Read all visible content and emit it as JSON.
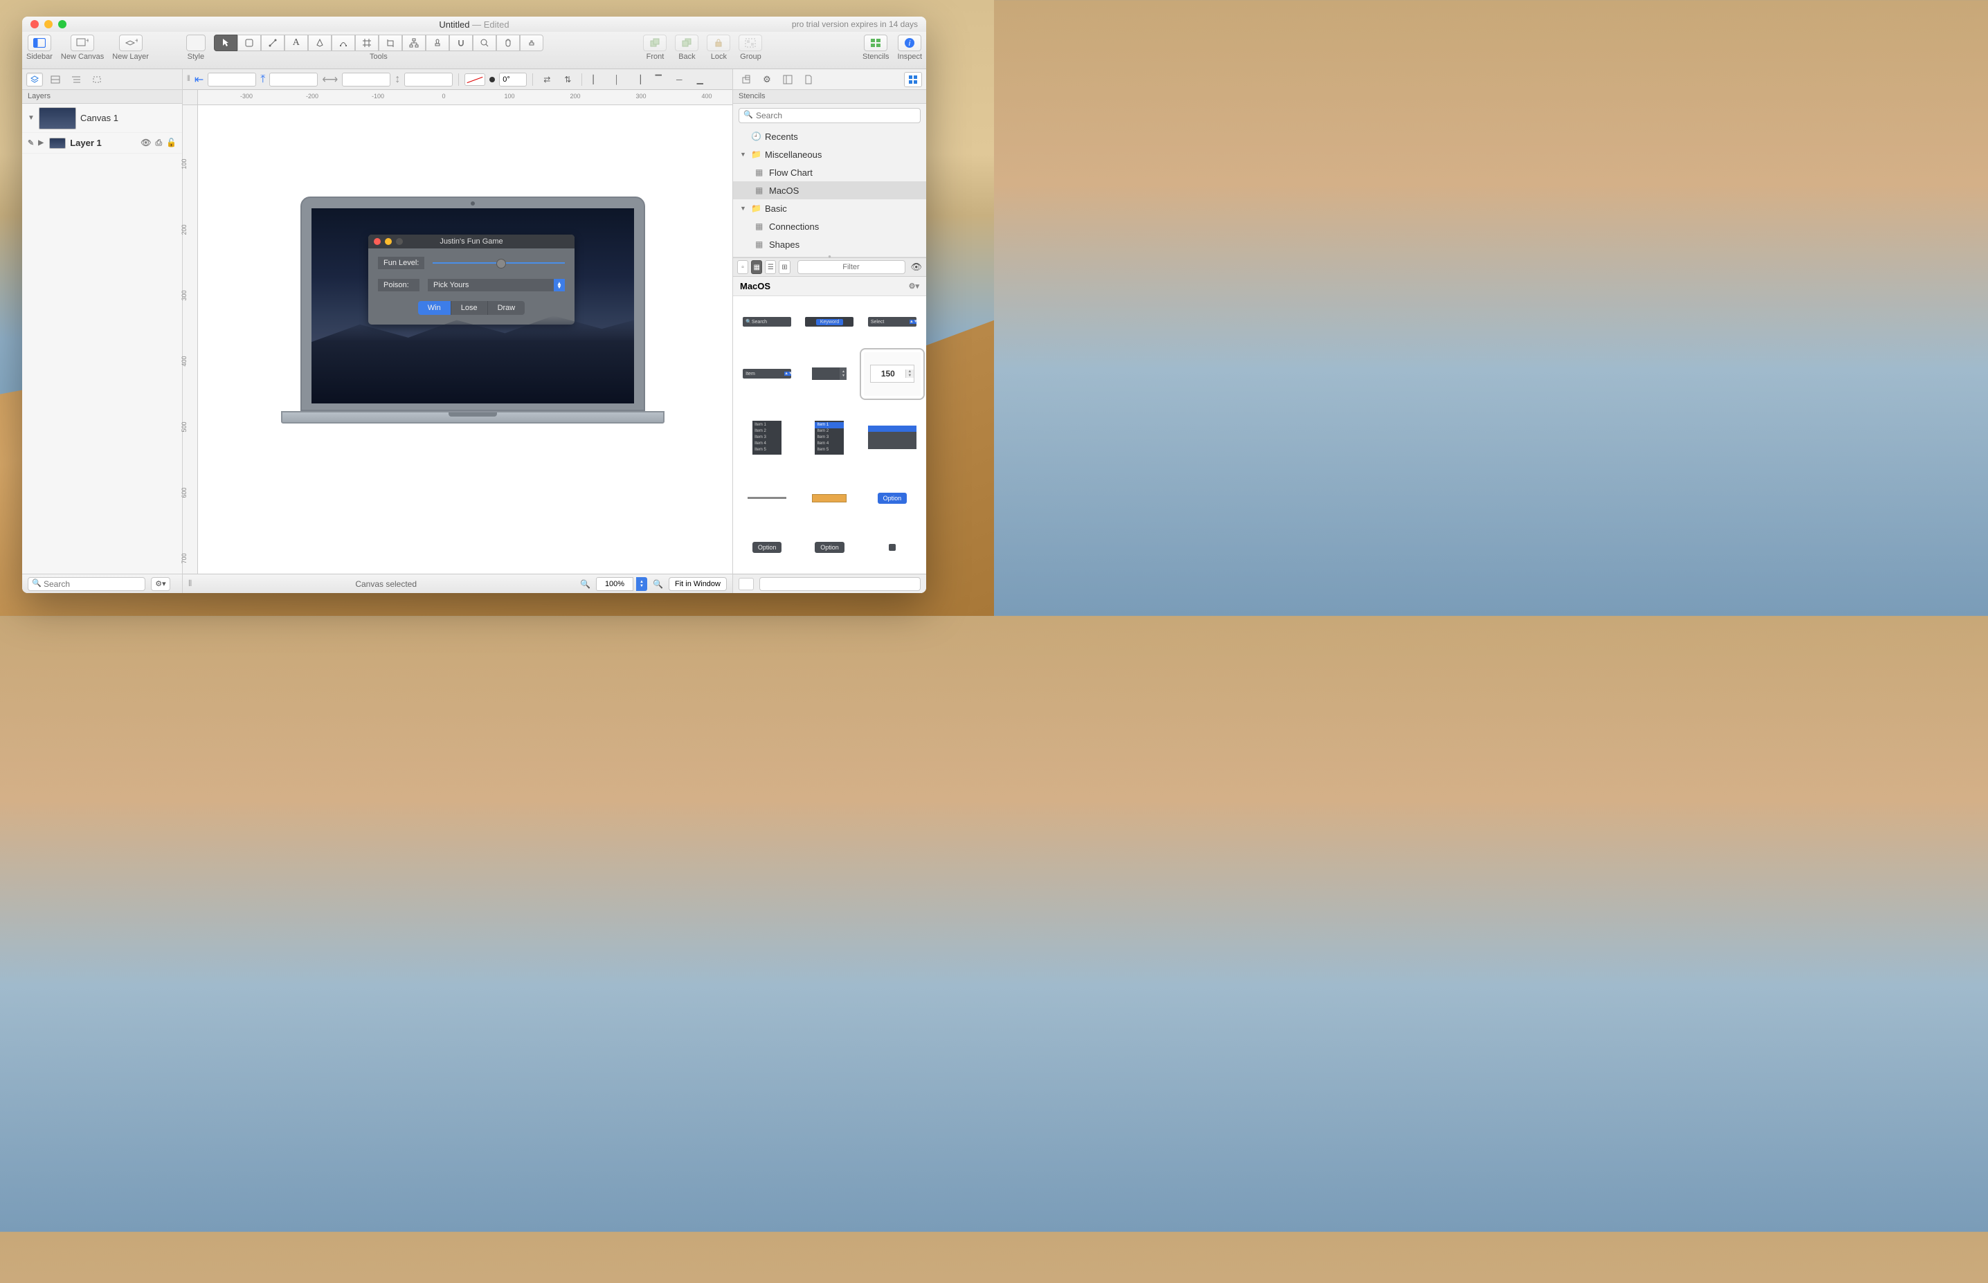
{
  "window": {
    "title": "Untitled",
    "edited_suffix": " — Edited",
    "trial_notice": "pro trial version expires in 14 days"
  },
  "toolbar": {
    "groups": {
      "sidebar": "Sidebar",
      "new_canvas": "New Canvas",
      "new_layer": "New Layer",
      "style": "Style",
      "tools": "Tools",
      "front": "Front",
      "back": "Back",
      "lock": "Lock",
      "group": "Group",
      "stencils": "Stencils",
      "inspect": "Inspect"
    }
  },
  "formatbar": {
    "rotation": "0°"
  },
  "left_sidebar": {
    "section_label": "Layers",
    "canvas_name": "Canvas 1",
    "layer_name": "Layer 1",
    "search_placeholder": "Search"
  },
  "ruler_h": [
    "-300",
    "-200",
    "-100",
    "0",
    "100",
    "200",
    "300",
    "400"
  ],
  "ruler_v": [
    "100",
    "200",
    "300",
    "400",
    "500",
    "600",
    "700"
  ],
  "mockup": {
    "game_title": "Justin's Fun Game",
    "fun_label": "Fun Level:",
    "poison_label": "Poison:",
    "poison_value": "Pick Yours",
    "seg": [
      "Win",
      "Lose",
      "Draw"
    ]
  },
  "right_sidebar": {
    "section_label": "Stencils",
    "search_placeholder": "Search",
    "recents": "Recents",
    "folders": {
      "misc": "Miscellaneous",
      "flowchart": "Flow Chart",
      "macos": "MacOS",
      "basic": "Basic",
      "connections": "Connections",
      "shapes": "Shapes"
    },
    "filter_placeholder": "Filter",
    "stencil_head": "MacOS",
    "widgets": {
      "search": "Search",
      "keyword": "Keyword",
      "select": "Select",
      "item": "Item",
      "num": "150",
      "list_items": [
        "Item 1",
        "Item 2",
        "Item 3",
        "Item 4",
        "Item 5"
      ],
      "option": "Option"
    }
  },
  "statusbar": {
    "message": "Canvas selected",
    "zoom": "100%",
    "fit": "Fit in Window"
  }
}
